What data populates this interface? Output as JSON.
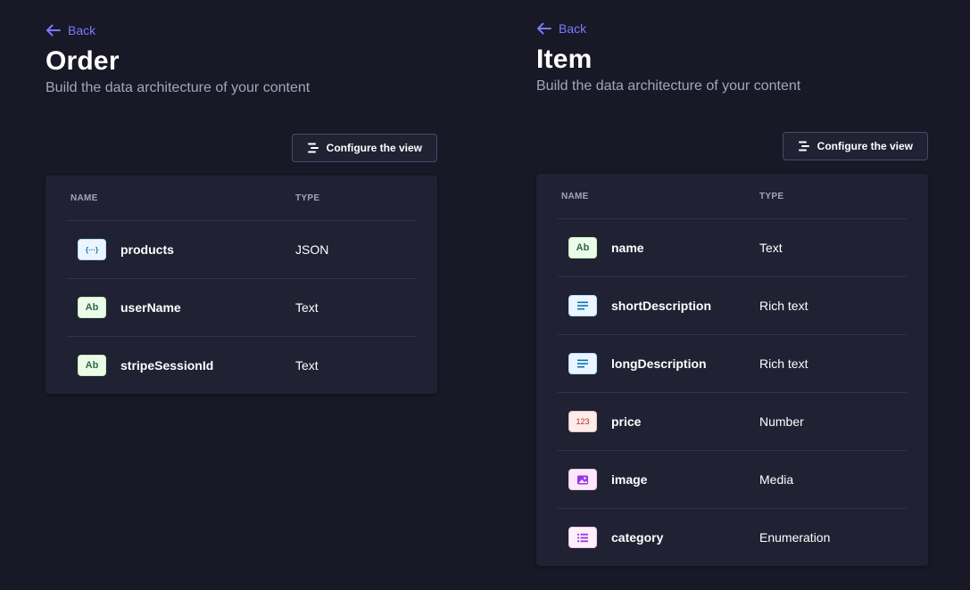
{
  "panels": {
    "order": {
      "back_label": "Back",
      "title": "Order",
      "subtitle": "Build the data architecture of your content",
      "configure_label": "Configure the view",
      "columns": {
        "name": "NAME",
        "type": "TYPE"
      },
      "fields": [
        {
          "name": "products",
          "type": "JSON",
          "icon": "json-icon",
          "icon_text": "{···}"
        },
        {
          "name": "userName",
          "type": "Text",
          "icon": "text-icon",
          "icon_text": "Ab"
        },
        {
          "name": "stripeSessionId",
          "type": "Text",
          "icon": "text-icon",
          "icon_text": "Ab"
        }
      ]
    },
    "item": {
      "back_label": "Back",
      "title": "Item",
      "subtitle": "Build the data architecture of your content",
      "configure_label": "Configure the view",
      "columns": {
        "name": "NAME",
        "type": "TYPE"
      },
      "fields": [
        {
          "name": "name",
          "type": "Text",
          "icon": "text-icon",
          "icon_text": "Ab"
        },
        {
          "name": "shortDescription",
          "type": "Rich text",
          "icon": "rich-text-icon"
        },
        {
          "name": "longDescription",
          "type": "Rich text",
          "icon": "rich-text-icon"
        },
        {
          "name": "price",
          "type": "Number",
          "icon": "number-icon",
          "icon_text": "123"
        },
        {
          "name": "image",
          "type": "Media",
          "icon": "media-icon"
        },
        {
          "name": "category",
          "type": "Enumeration",
          "icon": "enumeration-icon"
        }
      ]
    }
  },
  "colors": {
    "background": "#181826",
    "card": "#212134",
    "accent": "#7b79ff",
    "muted_text": "#a5a5ba"
  }
}
